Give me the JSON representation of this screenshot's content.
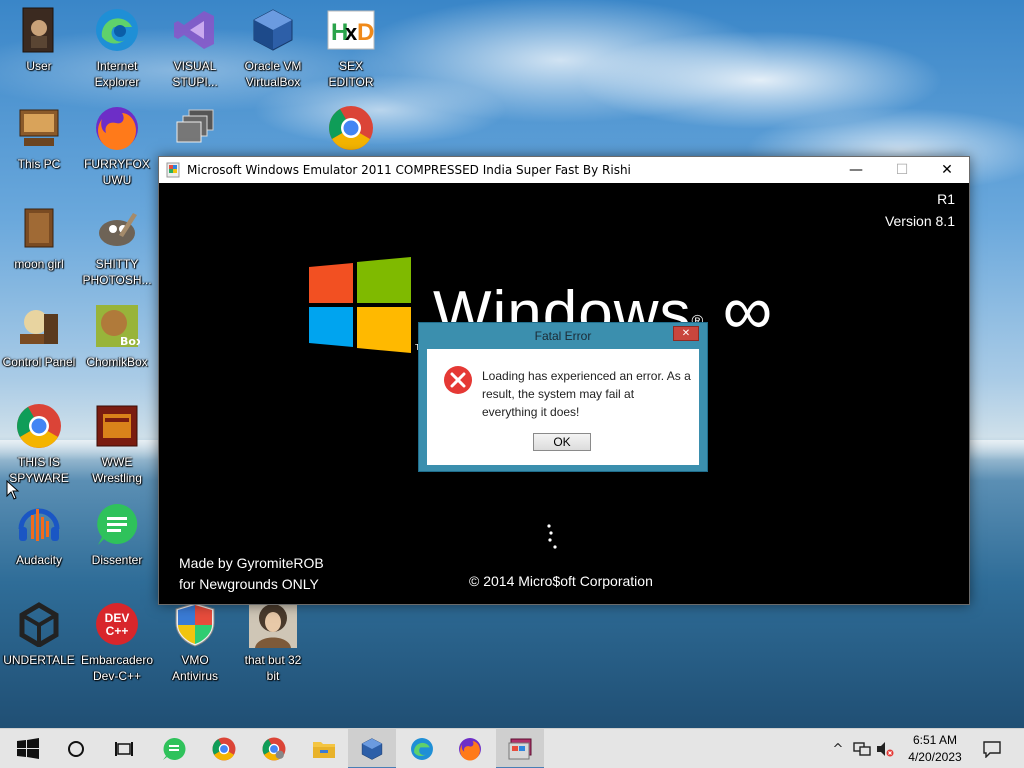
{
  "desktop_icons": [
    {
      "label": "User",
      "icon": "user-folder-icon"
    },
    {
      "label": "Internet\nExplorer",
      "icon": "edge-icon"
    },
    {
      "label": "VISUAL\nSTUPI...",
      "icon": "visual-studio-icon"
    },
    {
      "label": "Oracle VM\nVirtualBox",
      "icon": "virtualbox-icon"
    },
    {
      "label": "SEX\nEDITOR",
      "icon": "hex-editor-icon"
    },
    {
      "label": "This PC",
      "icon": "this-pc-icon"
    },
    {
      "label": "FURRYFOX\nUWU",
      "icon": "firefox-icon"
    },
    {
      "label": "",
      "icon": "windows-stack-icon"
    },
    {
      "label": "",
      "icon": "chrome-canary-icon"
    },
    {
      "label": "moon girl",
      "icon": "moon-girl-icon"
    },
    {
      "label": "SHITTY\nPHOTOSH...",
      "icon": "gimp-icon"
    },
    {
      "label": "Control Panel",
      "icon": "control-panel-icon"
    },
    {
      "label": "ChomikBox",
      "icon": "chomikbox-icon"
    },
    {
      "label": "THIS IS\nSPYWARE",
      "icon": "chrome-icon"
    },
    {
      "label": "WWE\nWrestling",
      "icon": "wwe-icon"
    },
    {
      "label": "Audacity",
      "icon": "audacity-icon"
    },
    {
      "label": "Dissenter",
      "icon": "dissenter-icon"
    },
    {
      "label": "UNDERTALE",
      "icon": "unity-icon"
    },
    {
      "label": "Embarcadero\nDev-C++",
      "icon": "devcpp-icon"
    },
    {
      "label": "VMO\nAntivirus",
      "icon": "antivirus-shield-icon"
    },
    {
      "label": "that but 32\nbit",
      "icon": "portrait-icon"
    }
  ],
  "window": {
    "title": "Microsoft Windows Emulator 2011 COMPRESSED India Super Fast By Rishi",
    "minimize": "—",
    "maximize": "☐",
    "close": "✕",
    "revision": "R1",
    "version": "Version 8.1",
    "brand": "Windows",
    "brand_reg": "®",
    "brand_suffix": "∞",
    "tm": "TM",
    "credits_line1": "Made by GyromiteROB",
    "credits_line2": "for Newgrounds ONLY",
    "copyright": "© 2014 Micro$oft Corporation",
    "logo_colors": [
      "#f25022",
      "#7fba00",
      "#00a4ef",
      "#ffb900"
    ]
  },
  "dialog": {
    "title": "Fatal Error",
    "close": "✕",
    "message": "Loading has experienced an error. As a result, the system may fail at everything it does!",
    "ok": "OK"
  },
  "taskbar": {
    "items": [
      {
        "icon": "start-windows-icon"
      },
      {
        "icon": "cortana-circle-icon"
      },
      {
        "icon": "task-view-icon"
      },
      {
        "icon": "dissenter-icon"
      },
      {
        "icon": "chrome-icon"
      },
      {
        "icon": "chrome-canary-icon"
      },
      {
        "icon": "file-explorer-icon"
      },
      {
        "icon": "virtualbox-icon"
      },
      {
        "icon": "edge-icon"
      },
      {
        "icon": "firefox-icon"
      },
      {
        "icon": "emulator-app-icon"
      }
    ],
    "tray": {
      "chevron": "^",
      "time": "6:51 AM",
      "date": "4/20/2023"
    }
  }
}
